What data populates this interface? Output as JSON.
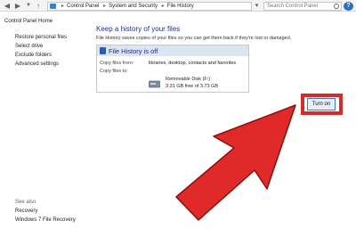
{
  "address_bar": {
    "crumbs": [
      "Control Panel",
      "System and Security",
      "File History"
    ],
    "search_placeholder": "Search Control Panel"
  },
  "sidebar": {
    "home": "Control Panel Home",
    "links": [
      "Restore personal files",
      "Select drive",
      "Exclude folders",
      "Advanced settings"
    ],
    "see_also": "See also",
    "see_also_links": [
      "Recovery",
      "Windows 7 File Recovery"
    ]
  },
  "main": {
    "title": "Keep a history of your files",
    "description": "File History saves copies of your files so you can get them back if they're lost or damaged.",
    "panel": {
      "status": "File History is off",
      "copy_from_label": "Copy files from:",
      "copy_from_value": "libraries, desktop, contacts and favorites",
      "copy_to_label": "Copy files to:",
      "drive_name": "Removable Disk (F:)",
      "drive_space": "3.31 GB free of 3.73 GB"
    },
    "turn_on_label": "Turn on"
  },
  "colors": {
    "accent_title": "#1e3287",
    "highlight_red": "#d62b2b",
    "arrow_red": "#e02a2a"
  },
  "icons": [
    "back-icon",
    "forward-icon",
    "up-icon",
    "control-panel-icon",
    "refresh-icon",
    "search-icon",
    "help-icon",
    "file-history-icon",
    "removable-disk-icon"
  ]
}
